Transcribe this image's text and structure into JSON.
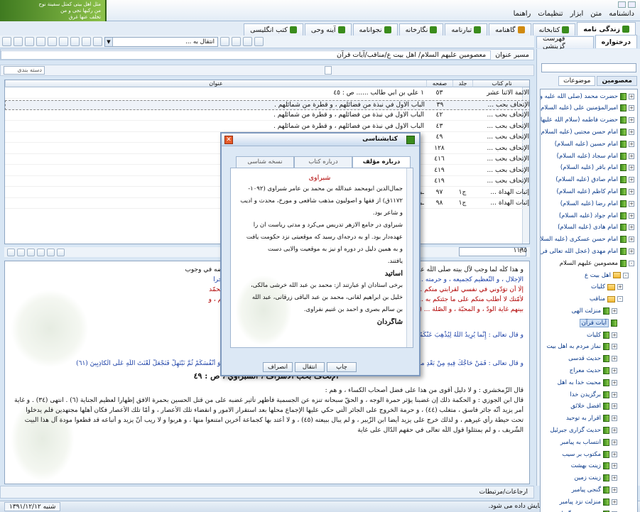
{
  "logo": {
    "line1": "مثل اهل بیتی کمثل سفینة نوح",
    "line2": "من رکبها نجی و من",
    "line3": "تخلف عنها غرق",
    "brand": "جامع الأحادیث"
  },
  "menu": [
    "دانشنامه",
    "متن",
    "ابزار",
    "تنظیمات",
    "راهنما"
  ],
  "tabs": [
    {
      "label": "زندگی نامه",
      "color": "#3a8c1c"
    },
    {
      "label": "کتابخانه",
      "color": "#3a8c1c"
    },
    {
      "label": "گاهنامه",
      "color": "#d08a10"
    },
    {
      "label": "تبارنامه",
      "color": "#3a8c1c"
    },
    {
      "label": "نگارخانه",
      "color": "#3a8c1c"
    },
    {
      "label": "نجوانامه",
      "color": "#3a8c1c"
    },
    {
      "label": "آینه وحی",
      "color": "#3a8c1c"
    },
    {
      "label": "کتب انگلیسی",
      "color": "#3a8c1c"
    }
  ],
  "toolbar": {
    "combo_text": "انتقال به ...",
    "combo_arrow": "▼"
  },
  "side_tabs": {
    "tab1": "درختواره",
    "tab2": "فهرست گزینشی"
  },
  "breadcrumb": {
    "label": "مسیر عنوان",
    "path": "معصومین علیهم السلام/ اهل بیت ع/مناقب/آیات قرآن"
  },
  "search_row": {
    "label": "دسته بندی"
  },
  "list": {
    "headers": {
      "book": "نام کتاب",
      "vol": "جلد",
      "page": "صفحه",
      "title": "عنوان"
    },
    "rows": [
      {
        "book": "الأئمة الاثنا عشر",
        "vol": "",
        "page": "٥٣",
        "title": "١ علي بن أبي طالب ...... ص : ٤٥"
      },
      {
        "book": "الإتحاف بحب ...",
        "vol": "",
        "page": "٣٩",
        "title": "الباب الأول في نبذة من فضائلهم ، و قطرة من شمائلهم ."
      },
      {
        "book": "الإتحاف بحب ...",
        "vol": "",
        "page": "٤٢",
        "title": "الباب الأول في نبذة من فضائلهم ، و قطرة من شمائلهم ."
      },
      {
        "book": "الإتحاف بحب ...",
        "vol": "",
        "page": "٤٣",
        "title": "الباب الأول في نبذة من فضائلهم ، و قطرة من شمائلهم ."
      },
      {
        "book": "الإتحاف بحب ...",
        "vol": "",
        "page": "٤٩",
        "title": ""
      },
      {
        "book": "الإتحاف بحب ...",
        "vol": "",
        "page": "١٢٨",
        "title": ""
      },
      {
        "book": "الإتحاف بحب ...",
        "vol": "",
        "page": "٤١٦",
        "title": ""
      },
      {
        "book": "الإتحاف بحب ...",
        "vol": "",
        "page": "٤١٩",
        "title": ""
      },
      {
        "book": "الإتحاف بحب ...",
        "vol": "",
        "page": "٤١٩",
        "title": ""
      },
      {
        "book": "إثبات الهداة ...",
        "vol": "ج١",
        "page": "٩٧",
        "title": "ـبياء و الأئمة ..... ص : ٩٧"
      },
      {
        "book": "إثبات الهداة ...",
        "vol": "ج١",
        "page": "٩٨",
        "title": "ـبياء و الأئمة ..... ص : ٩٧"
      }
    ]
  },
  "nav": {
    "count": "١١٦٥",
    "index": "٢"
  },
  "text_lines": [
    {
      "t": "و هذا كلّه لما وجب لآل بيته صلّى اللّه عليه [و آله] و سلّم ، و سريان لحمه ، و دمه الكريمين فيهم ، فهم بعضه ، و بعضه في وجوب",
      "c": ""
    },
    {
      "t": "الإجلال ، و التّعظيم كجميعه ، و حرمته ... أَجْراً إِلَّا الْمَوَدَّةَ فِي الْقُرْبى (٣١) ، قال ابن عباس : المعنى لا أسألكم عليه أجرا",
      "c": "blue"
    },
    {
      "t": "إلّا أن توَدّوني في نفسي لقرابتي منكم ... سلّم قرابة ، لكن الأنسب ما قاله غيره في تفسير الآية : إِنَّ المعنى قل يا محمّد",
      "c": "red"
    },
    {
      "t": "لأمّتك لا أطلب منكم على ما جئتكم به ... تودّوا قرابتي ، و تحبّوهم ، و تعاملوهم بالمعروف ، و الإحسان ، و يكون بينكم ، و",
      "c": "red"
    },
    {
      "t": "بينهم غاية الودّ ، و المحبّة ، و الصّلة ... (٥٥)",
      "c": "red"
    },
    {
      "t": "٤٣ :ص",
      "c": "head"
    },
    {
      "t": "و قال تعالى : إِنَّما يُرِيدُ اللَّهُ لِيُذْهِبَ عَنْكُمُ ...",
      "c": "blue"
    },
    {
      "t": "٤٣ :ص",
      "c": "head"
    },
    {
      "t": "و قال تعالى : فَمَنْ حَاجَّكَ فِيهِ مِنْ بَعْدِ ما جاءَكَ مِنَ الْعِلْمِ فَقُلْ تَعالَوْا نَدْعُ أَبْناءَنا وَ أَبْناءَكُمْ وَ نِساءَنا وَ نِساءَكُمْ وَ أَنْفُسَنا وَ أَنْفُسَكُمْ ثُمَّ نَبْتَهِلْ فَنَجْعَلْ لَعْنَتَ اللَّهِ عَلَى الْكاذِبِينَ (٦١)",
      "c": "blue"
    },
    {
      "t": "الإتحاف بحب الأشراف ، الشبراوي ، ص : ٤٩",
      "c": "head"
    },
    {
      "t": "قال الزّمخشري : و لا دليل أقوى من هذا على فضل أصحاب الكساء ، و هم :",
      "c": ""
    },
    {
      "t": "قال ابن الجوزي : و الحكمة ذلك إن غضبنا يؤثر حمرة الوجه ، و الحقّ سبحانه تنزه عن الجسمية فأظهر تأثير غضبه على من قتل الحسين بحمرة الافق إظهارا لعظيم الجناية (٦) . انتهى (٣٤) . و غاية",
      "c": ""
    },
    {
      "t": "أمر يزيد أنّه جائر فاسق ، متغلب (٤٤) ، و حرمة الخروج على الجائر الّتي حكي عليها الإجماع محلها بعد استقرار الامور و انقضاء تلك الأعصار ، و أمّا تلك الأعصار فكان أهلها مجتهدين فلم يدخلوا",
      "c": ""
    },
    {
      "t": "تحت حيطة رأي غيرهم ، و لذلك خرج على يزيد أيضا ابن الزّبير ، و لم يبال ببيعته (٤٥) ، و لا أعتد بها كجماعة آخرين امتنعوا منها ، و هربوا و لا ريب أنّ يزيد و أتباعه قد قطعوا مودة آل هذا البيت",
      "c": ""
    },
    {
      "t": "الشّريف ، و لم يمتثلوا قول اللّه تعالى في حقهم الدّال على غاية",
      "c": ""
    }
  ],
  "bottom": {
    "label": "ارجاعات/مرتبطات"
  },
  "status": {
    "date": "شنبه ١٣٩١/١٢/١٢",
    "message": "متن پاسخ های فوق در متن جاری نمایش داده می شود."
  },
  "sidebar": {
    "tab_masomin": "معصومین",
    "tab_mowzuat": "موضوعات",
    "tree": [
      {
        "label": "حضرت محمد (صلی الله علیه و",
        "kind": "bk",
        "lvl": 0,
        "pm": "+"
      },
      {
        "label": "امیرالمؤمنین علی (علیه السلام)",
        "kind": "bk",
        "lvl": 0,
        "pm": "+"
      },
      {
        "label": "حضرت فاطمه (سلام الله علیها)",
        "kind": "bk",
        "lvl": 0,
        "pm": "+"
      },
      {
        "label": "امام حسن مجتبی (علیه السلام)",
        "kind": "bk",
        "lvl": 0,
        "pm": "+"
      },
      {
        "label": "امام حسین (علیه السلام)",
        "kind": "bk",
        "lvl": 0,
        "pm": "+"
      },
      {
        "label": "امام سجاد (علیه السلام)",
        "kind": "bk",
        "lvl": 0,
        "pm": "+"
      },
      {
        "label": "امام باقر (علیه السلام)",
        "kind": "bk",
        "lvl": 0,
        "pm": "+"
      },
      {
        "label": "امام صادق (علیه السلام)",
        "kind": "bk",
        "lvl": 0,
        "pm": "+"
      },
      {
        "label": "امام کاظم (علیه السلام)",
        "kind": "bk",
        "lvl": 0,
        "pm": "+"
      },
      {
        "label": "امام رضا (علیه السلام)",
        "kind": "bk",
        "lvl": 0,
        "pm": "+"
      },
      {
        "label": "امام جواد (علیه السلام)",
        "kind": "bk",
        "lvl": 0,
        "pm": "+"
      },
      {
        "label": "امام هادی (علیه السلام)",
        "kind": "bk",
        "lvl": 0,
        "pm": "+"
      },
      {
        "label": "امام حسن عسکری (علیه السلام)",
        "kind": "bk",
        "lvl": 0,
        "pm": "+"
      },
      {
        "label": "امام مهدی (عجل الله تعالی فرج",
        "kind": "bk",
        "lvl": 0,
        "pm": "+"
      },
      {
        "label": "معصومین علیهم السلام",
        "kind": "bk",
        "lvl": 0,
        "pm": "-",
        "blk": true
      },
      {
        "label": "اهل بیت ع",
        "kind": "fd",
        "lvl": 1,
        "pm": "-"
      },
      {
        "label": "کلیات",
        "kind": "fd",
        "lvl": 2,
        "pm": "+"
      },
      {
        "label": "مناقب",
        "kind": "fd",
        "lvl": 2,
        "pm": "-"
      },
      {
        "label": "منزلت الهی",
        "kind": "bk",
        "lvl": 3,
        "pm": "+"
      },
      {
        "label": "آیات قرآن",
        "kind": "bk",
        "lvl": 3,
        "pm": "",
        "hl": true
      },
      {
        "label": "کلیات",
        "kind": "bk",
        "lvl": 3,
        "pm": "+"
      },
      {
        "label": "نماز مردم به اهل بیت",
        "kind": "bk",
        "lvl": 3,
        "pm": "+"
      },
      {
        "label": "حدیث قدسی",
        "kind": "bk",
        "lvl": 3,
        "pm": "+"
      },
      {
        "label": "حدیث معراج",
        "kind": "bk",
        "lvl": 3,
        "pm": "+"
      },
      {
        "label": "محبت خدا به اهل",
        "kind": "bk",
        "lvl": 3,
        "pm": "+"
      },
      {
        "label": "برگزیدن خدا",
        "kind": "bk",
        "lvl": 3,
        "pm": "+"
      },
      {
        "label": "افضل خلائق",
        "kind": "bk",
        "lvl": 3,
        "pm": "+"
      },
      {
        "label": "اقرار به توحید",
        "kind": "bk",
        "lvl": 3,
        "pm": "+"
      },
      {
        "label": "حدیث گزاری جبرئیل",
        "kind": "bk",
        "lvl": 3,
        "pm": "+"
      },
      {
        "label": "انتساب به پیامبر",
        "kind": "bk",
        "lvl": 3,
        "pm": "+"
      },
      {
        "label": "مکتوب بر سیب",
        "kind": "bk",
        "lvl": 3,
        "pm": "+"
      },
      {
        "label": "زینت بهشت",
        "kind": "bk",
        "lvl": 3,
        "pm": "+"
      },
      {
        "label": "زینت زمین",
        "kind": "bk",
        "lvl": 3,
        "pm": "+"
      },
      {
        "label": "گنجی پیامبر",
        "kind": "bk",
        "lvl": 3,
        "pm": "+"
      },
      {
        "label": "منزلت نزد پیامبر",
        "kind": "bk",
        "lvl": 3,
        "pm": "+"
      },
      {
        "label": "مجموعه در گفتار پ",
        "kind": "bk",
        "lvl": 3,
        "pm": "+"
      }
    ]
  },
  "dialog": {
    "title": "کتابشناسی",
    "tabs": [
      "درباره مؤلف",
      "درباره کتاب",
      "نسخه شناسی"
    ],
    "author_name": "شبراوی",
    "lines": [
      {
        "t": "جمال‌الدین ابومحمد عبدالله بن محمد بن عامر شبراوی (١٠٩٢-",
        "c": ""
      },
      {
        "t": "١١٧٢ق) از فقها و اصولیون مذهب شافعی و مورخ، محدث و ادیب",
        "c": ""
      },
      {
        "t": "و شاعر بود.",
        "c": ""
      },
      {
        "t": "شبراوی در جامع الازهر تدریس می‌کرد و مدتی ریاست آن را",
        "c": ""
      },
      {
        "t": "عهده‌دار بود. او به درجه‌ای رسید که موقعیتی نزد حکومت یافت",
        "c": ""
      },
      {
        "t": "و به همین دلیل در دوره او نیز به موقعیت والایی دست",
        "c": ""
      },
      {
        "t": "یافتند.",
        "c": ""
      },
      {
        "t": "اساتید",
        "c": "sec"
      },
      {
        "t": "برخی استادان او عبارتند از: محمد بن عبد الله خرشی مالکی،",
        "c": ""
      },
      {
        "t": "خلیل بن ابراهیم لقانی، محمد بن عبد الباقی زرقانی، عبد الله",
        "c": ""
      },
      {
        "t": "بن سالم بصری و احمد بن غنیم نفراوی.",
        "c": ""
      },
      {
        "t": "شاگردان",
        "c": "sec"
      }
    ],
    "buttons": [
      "چاپ",
      "انتقال",
      "انصراف"
    ]
  }
}
